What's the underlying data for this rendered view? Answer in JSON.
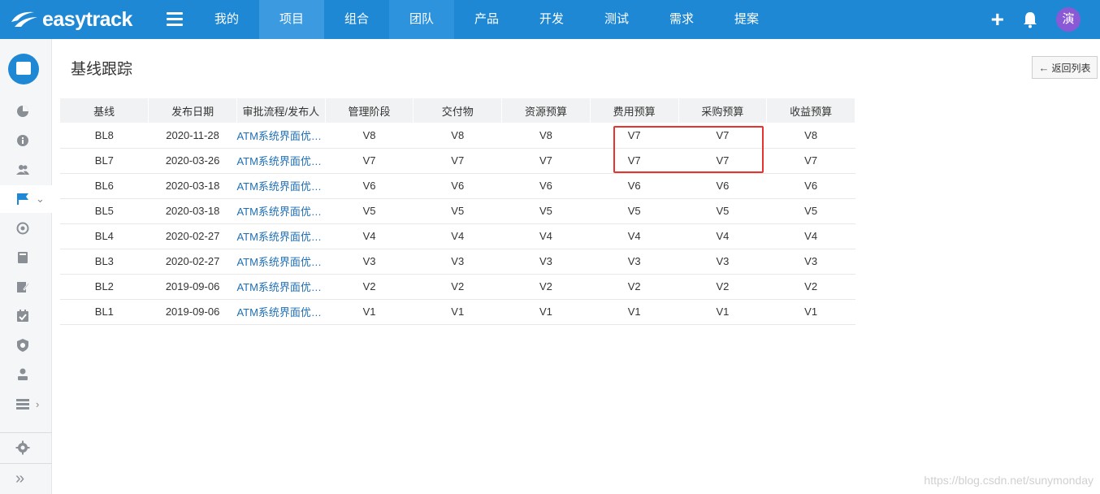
{
  "app": {
    "logo_text": "easytrack"
  },
  "nav": {
    "items": [
      {
        "label": "我的"
      },
      {
        "label": "项目"
      },
      {
        "label": "组合"
      },
      {
        "label": "团队"
      },
      {
        "label": "产品"
      },
      {
        "label": "开发"
      },
      {
        "label": "测试"
      },
      {
        "label": "需求"
      },
      {
        "label": "提案"
      }
    ],
    "active": "项目"
  },
  "user": {
    "avatar_text": "演"
  },
  "page": {
    "title": "基线跟踪",
    "back_label": "返回列表"
  },
  "table": {
    "headers": [
      "基线",
      "发布日期",
      "审批流程/发布人",
      "管理阶段",
      "交付物",
      "资源预算",
      "费用预算",
      "采购预算",
      "收益预算"
    ],
    "rows": [
      [
        "BL8",
        "2020-11-28",
        "ATM系统界面优化项目管...",
        "V8",
        "V8",
        "V8",
        "V7",
        "V7",
        "V8"
      ],
      [
        "BL7",
        "2020-03-26",
        "ATM系统界面优化项目管...",
        "V7",
        "V7",
        "V7",
        "V7",
        "V7",
        "V7"
      ],
      [
        "BL6",
        "2020-03-18",
        "ATM系统界面优化项目管...",
        "V6",
        "V6",
        "V6",
        "V6",
        "V6",
        "V6"
      ],
      [
        "BL5",
        "2020-03-18",
        "ATM系统界面优化项目管...",
        "V5",
        "V5",
        "V5",
        "V5",
        "V5",
        "V5"
      ],
      [
        "BL4",
        "2020-02-27",
        "ATM系统界面优化项目管...",
        "V4",
        "V4",
        "V4",
        "V4",
        "V4",
        "V4"
      ],
      [
        "BL3",
        "2020-02-27",
        "ATM系统界面优化项目管...",
        "V3",
        "V3",
        "V3",
        "V3",
        "V3",
        "V3"
      ],
      [
        "BL2",
        "2019-09-06",
        "ATM系统界面优化项目管...",
        "V2",
        "V2",
        "V2",
        "V2",
        "V2",
        "V2"
      ],
      [
        "BL1",
        "2019-09-06",
        "ATM系统界面优化项目管...",
        "V1",
        "V1",
        "V1",
        "V1",
        "V1",
        "V1"
      ]
    ]
  },
  "sidebar": {
    "icons": [
      "pie-chart-icon",
      "info-icon",
      "users-icon",
      "flag-icon",
      "target-icon",
      "book-icon",
      "edit-icon",
      "calendar-check-icon",
      "shield-icon",
      "person-icon",
      "server-icon",
      "settings-icon",
      "double-chevron-right-icon"
    ],
    "active": "flag-icon"
  },
  "watermark": "https://blog.csdn.net/sunymonday",
  "colors": {
    "topbar": "#1f88d4",
    "link": "#1f6fb5",
    "highlight_box": "#e8332c",
    "avatar": "#8a5ad6"
  }
}
